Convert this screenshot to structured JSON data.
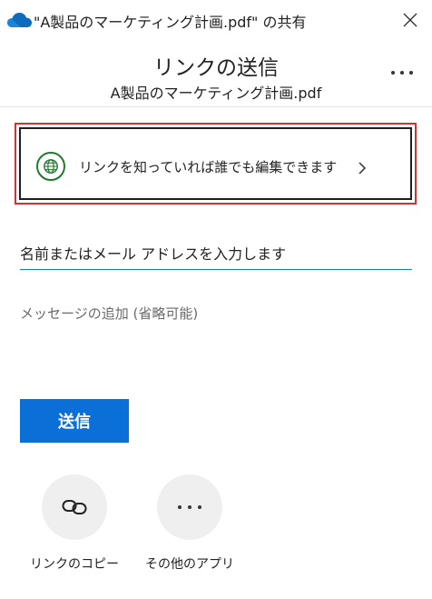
{
  "titlebar": {
    "app_icon": "onedrive-cloud-icon",
    "title": "\"A製品のマーケティング計画.pdf\" の共有",
    "close_icon": "close-icon"
  },
  "header": {
    "title": "リンクの送信",
    "subtitle": "A製品のマーケティング計画.pdf",
    "more_icon": "more-options-icon"
  },
  "link_settings": {
    "icon": "globe-icon",
    "label": "リンクを知っていれば誰でも編集できます",
    "chevron_icon": "chevron-right-icon",
    "icon_color": "#1f7a2e",
    "highlight_color": "#d92f2f"
  },
  "recipient": {
    "placeholder": "名前またはメール アドレスを入力します"
  },
  "message": {
    "placeholder": "メッセージの追加 (省略可能)"
  },
  "send_button": {
    "label": "送信",
    "color": "#0a6fd6"
  },
  "actions": [
    {
      "icon": "link-icon",
      "label": "リンクのコピー"
    },
    {
      "icon": "more-horizontal-icon",
      "label": "その他のアプリ"
    }
  ]
}
